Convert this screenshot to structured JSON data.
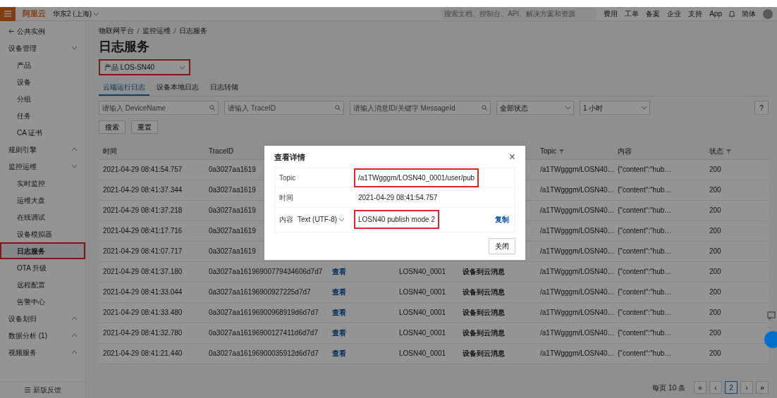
{
  "topbar": {
    "logo": "阿里云",
    "region": "华东2 (上海)",
    "search": {
      "placeholder": "搜索文档、控制台、API、解决方案和资源"
    },
    "menu": [
      "费用",
      "工单",
      "备案",
      "企业",
      "支持",
      "App"
    ],
    "language": "简体"
  },
  "sidebar": {
    "back": "公共实例",
    "items": [
      {
        "label": "设备管理",
        "expanded": true,
        "children": [
          {
            "label": "产品",
            "selected": false,
            "annotated": false
          },
          {
            "label": "设备",
            "selected": false,
            "annotated": false
          },
          {
            "label": "分组",
            "selected": false,
            "annotated": false
          },
          {
            "label": "任务",
            "selected": false,
            "annotated": false
          },
          {
            "label": "CA 证书",
            "selected": false,
            "annotated": false
          }
        ]
      },
      {
        "label": "规则引擎",
        "expanded": false
      },
      {
        "label": "监控运维",
        "expanded": true,
        "children": [
          {
            "label": "实时监控",
            "selected": false,
            "annotated": false
          },
          {
            "label": "运维大盘",
            "selected": false,
            "annotated": false
          },
          {
            "label": "在线调试",
            "selected": false,
            "annotated": false
          },
          {
            "label": "设备模拟器",
            "selected": false,
            "annotated": false
          },
          {
            "label": "日志服务",
            "selected": true,
            "annotated": true
          },
          {
            "label": "OTA 升级",
            "selected": false,
            "annotated": false
          },
          {
            "label": "远程配置",
            "selected": false,
            "annotated": false
          },
          {
            "label": "告警中心",
            "selected": false,
            "annotated": false
          }
        ]
      },
      {
        "label": "设备划归",
        "expanded": false
      },
      {
        "label": "数据分析 (1)",
        "expanded": false
      },
      {
        "label": "视频服务",
        "expanded": false
      }
    ],
    "feedback": "新版反馈"
  },
  "breadcrumb": [
    "物联网平台",
    "监控运维",
    "日志服务"
  ],
  "title": "日志服务",
  "product_select": {
    "label": "产品",
    "value": "LOS-SN40",
    "annotated": true
  },
  "tabs": [
    {
      "label": "云端运行日志",
      "selected": true
    },
    {
      "label": "设备本地日志",
      "selected": false
    },
    {
      "label": "日志转储",
      "selected": false
    }
  ],
  "filters": [
    {
      "placeholder": "请输入 DeviceName"
    },
    {
      "placeholder": "请输入 TraceID"
    },
    {
      "placeholder": "请输入消息ID/关键字 MessageId"
    }
  ],
  "status_select": "全部状态",
  "time_select": "1 小时",
  "buttons": [
    "搜索",
    "重置"
  ],
  "help": "?",
  "table": {
    "columns": [
      {
        "label": "时间",
        "filter": false
      },
      {
        "label": "TraceID",
        "filter": false
      },
      {},
      {},
      {},
      {
        "label": "Topic",
        "filter": true
      },
      {
        "label": "内容",
        "filter": false
      },
      {
        "label": "状态",
        "filter": true
      }
    ],
    "rows": [
      [
        "2021-04-29 08:41:54.757",
        "0a3027aa1619",
        null,
        null,
        null,
        "/a1TWgggm/LOSN40…",
        "{\"content\":\"hub…",
        "200"
      ],
      [
        "2021-04-29 08:41:37.344",
        "0a3027aa1619",
        null,
        null,
        null,
        "/a1TWgggm/LOSN40…",
        "{\"content\":\"hub…",
        "200"
      ],
      [
        "2021-04-29 08:41:37.218",
        "0a3027aa1619",
        null,
        null,
        null,
        "/a1TWgggm/LOSN40…",
        "{\"content\":\"hub…",
        "200"
      ],
      [
        "2021-04-29 08:41:17.716",
        "0a3027aa1619",
        null,
        null,
        null,
        "/a1TWgggm/LOSN40…",
        "{\"content\":\"hub…",
        "200"
      ],
      [
        "2021-04-29 08:41:07.717",
        "0a3027aa1619",
        null,
        null,
        null,
        "/a1TWgggm/LOSN40…",
        "{\"content\":\"hub…",
        "200"
      ],
      [
        "2021-04-29 08:41:37.180",
        "0a3027aa16196900779434606d7d7",
        "查看",
        "LOSN40_0001",
        "设备到云消息",
        "/a1TWgggm/LOSN40…",
        "{\"content\":\"hub…",
        "200"
      ],
      [
        "2021-04-29 08:41:33.044",
        "0a3027aa16196900927225d7d7",
        "查看",
        "LOSN40_0001",
        "设备到云消息",
        "/a1TWgggm/LOSN40…",
        "{\"content\":\"hub…",
        "200"
      ],
      [
        "2021-04-29 08:41:33.480",
        "0a3027aa16196900968919d6d7d7",
        "查看",
        "LOSN40_0001",
        "设备到云消息",
        "/a1TWgggm/LOSN40…",
        "{\"content\":\"hub…",
        "200"
      ],
      [
        "2021-04-29 08:41:32.780",
        "0a3027aa16196900127411d6d7d7",
        "查看",
        "LOSN40_0001",
        "设备到云消息",
        "/a1TWgggm/LOSN40…",
        "{\"content\":\"hub…",
        "200"
      ],
      [
        "2021-04-29 08:41:21.440",
        "0a3027aa16196900035912d6d7d7",
        "查看",
        "LOSN40_0001",
        "设备到云消息",
        "/a1TWgggm/LOSN40…",
        "{\"content\":\"hub…",
        "200"
      ]
    ]
  },
  "pagination": {
    "summary": "每页 10 条",
    "pages": [
      {
        "label": "«",
        "selected": false
      },
      {
        "label": "‹",
        "selected": false
      },
      {
        "label": "2",
        "selected": true
      },
      {
        "label": "›",
        "selected": false
      },
      {
        "label": "»",
        "selected": false
      }
    ]
  },
  "modal": {
    "title": "查看详情",
    "close": "×",
    "fields": [
      {
        "kind": "text",
        "label": "Topic",
        "value": "/a1TWgggm/LOSN40_0001/user/pub",
        "annotated": true
      },
      {
        "kind": "text",
        "label": "时间",
        "value": "2021-04-29 08:41:54.757",
        "annotated": false
      },
      {
        "kind": "content",
        "label": "内容",
        "format": "Text (UTF-8)",
        "value": "LOSN40 publish mode 2",
        "annotated": true,
        "action": "复制"
      }
    ],
    "button": "关闭"
  }
}
